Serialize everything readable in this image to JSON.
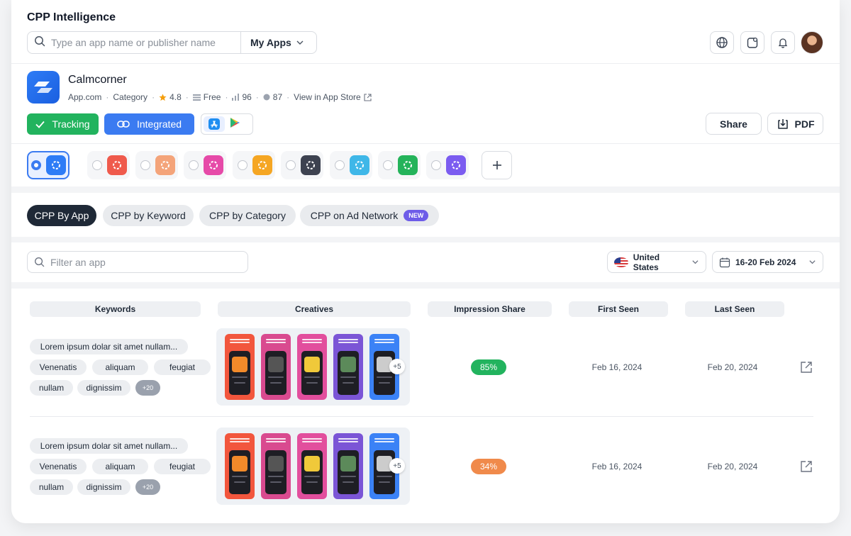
{
  "header": {
    "title": "CPP Intelligence",
    "search_placeholder": "Type an app name or publisher name",
    "my_apps_label": "My Apps",
    "icons": [
      "globe-icon",
      "widget-icon",
      "bell-icon"
    ]
  },
  "app": {
    "name": "Calmcorner",
    "meta": {
      "site": "App.com",
      "category": "Category",
      "rating": "4.8",
      "price": "Free",
      "stat1": "96",
      "stat2": "87",
      "store_link": "View in App Store"
    },
    "tracking_label": "Tracking",
    "integrated_label": "Integrated",
    "share_label": "Share",
    "pdf_label": "PDF"
  },
  "competitors": [
    {
      "color": "#2e7cf6",
      "selected": true
    },
    {
      "color": "#ef5a4c"
    },
    {
      "color": "#f4a47a"
    },
    {
      "color": "#e64aa8"
    },
    {
      "color": "#f5a623"
    },
    {
      "color": "#3d4250"
    },
    {
      "color": "#3fb7e8"
    },
    {
      "color": "#24b35a"
    },
    {
      "color": "#7b5cf0"
    }
  ],
  "tabs": [
    {
      "label": "CPP By App",
      "active": true
    },
    {
      "label": "CPP by Keyword"
    },
    {
      "label": "CPP by Category"
    },
    {
      "label": "CPP on Ad Network",
      "badge": "NEW"
    }
  ],
  "filters": {
    "filter_placeholder": "Filter an app",
    "country": "United States",
    "date_range": "16-20 Feb 2024"
  },
  "table": {
    "columns": [
      "Keywords",
      "Creatives",
      "Impression Share",
      "First Seen",
      "Last Seen"
    ],
    "rows": [
      {
        "keywords": [
          "Lorem ipsum dolar sit amet nullam...",
          "Venenatis",
          "aliquam",
          "feugiat",
          "nullam",
          "dignissim"
        ],
        "more_keywords": "+20",
        "more_creatives": "+5",
        "impression_share": "85%",
        "share_color": "#22b35e",
        "first_seen": "Feb 16, 2024",
        "last_seen": "Feb 20, 2024"
      },
      {
        "keywords": [
          "Lorem ipsum dolar sit amet nullam...",
          "Venenatis",
          "aliquam",
          "feugiat",
          "nullam",
          "dignissim"
        ],
        "more_keywords": "+20",
        "more_creatives": "+5",
        "impression_share": "34%",
        "share_color": "#f08a4b",
        "first_seen": "Feb 16, 2024",
        "last_seen": "Feb 20, 2024"
      }
    ],
    "creative_colors": [
      "#f2563d",
      "#d94a8f",
      "#e24e9d",
      "#7b55d6",
      "#3b82f6"
    ]
  }
}
